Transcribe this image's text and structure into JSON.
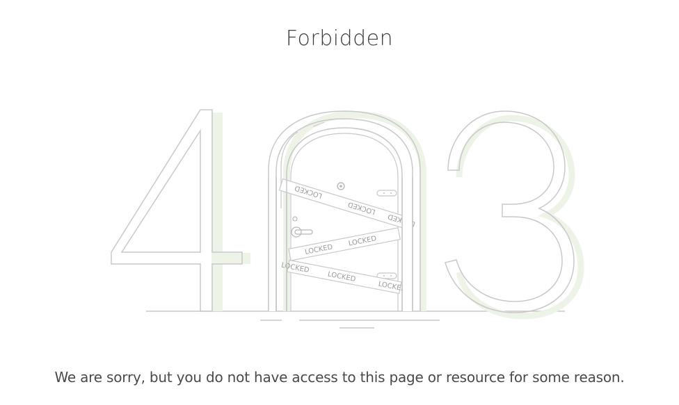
{
  "page": {
    "title": "Forbidden",
    "message": "We are sorry, but you do not have access to this page or resource for some reason."
  },
  "illustration": {
    "digits": {
      "first": "4",
      "last": "3"
    },
    "tape_text": "LOCKED",
    "stroke_color": "#c8c8c8",
    "shadow_color": "#eef3e8"
  }
}
